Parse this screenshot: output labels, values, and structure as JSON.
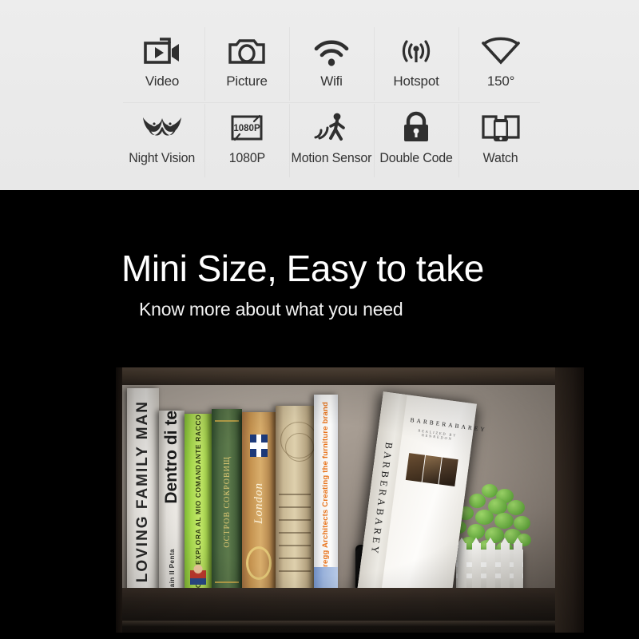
{
  "features": {
    "row1": [
      {
        "icon": "video-camera-icon",
        "label": "Video"
      },
      {
        "icon": "photo-camera-icon",
        "label": "Picture"
      },
      {
        "icon": "wifi-icon",
        "label": "Wifi"
      },
      {
        "icon": "hotspot-antenna-icon",
        "label": "Hotspot"
      },
      {
        "icon": "wide-angle-lens-icon",
        "label": "150°"
      }
    ],
    "row2": [
      {
        "icon": "owl-eyes-night-vision-icon",
        "label": "Night Vision"
      },
      {
        "icon": "screen-1080p-icon",
        "label": "1080P"
      },
      {
        "icon": "walking-person-motion-icon",
        "label": "Motion Sensor"
      },
      {
        "icon": "padlock-icon",
        "label": "Double Code"
      },
      {
        "icon": "two-phones-watch-icon",
        "label": "Watch"
      }
    ],
    "icon_1080p_text": "1080P"
  },
  "hero": {
    "headline": "Mini Size, Easy to take",
    "subheadline": "Know more about what you need"
  },
  "photo": {
    "caption_alt": "bookshelf-with-mini-camera-photo",
    "books": [
      {
        "name": "book-loving-family-man",
        "spine": "LOVING FAMILY MAN"
      },
      {
        "name": "book-dentro-di-te",
        "spine": "Dentro di te",
        "sub": "Alain II Penta"
      },
      {
        "name": "book-green-explorer",
        "spine": "A QUI TOCCA COLA EXPLORA AL MIO COMANDANTE RACCONTO MARCO"
      },
      {
        "name": "book-green-cloth",
        "spine": "ОСТРОВ СОКРОВИЩ"
      },
      {
        "name": "book-london",
        "spine": "London"
      },
      {
        "name": "book-map-paper",
        "spine": ""
      },
      {
        "name": "book-anderegg-architects",
        "spine": "Anderegg Architects Creating the furniture brand"
      }
    ],
    "big_book": {
      "name": "book-barberabarey",
      "spine": "BARBERABAREY",
      "spine_sub": "REALIZED BY HENREDON",
      "cover_title": "BARBERABAREY",
      "cover_sub": "REALIZED BY HENREDON"
    },
    "objects": [
      {
        "name": "mini-camera",
        "label": ""
      },
      {
        "name": "potted-plant",
        "label": ""
      }
    ]
  },
  "colors": {
    "panel_bg": "#ebebeb",
    "icon_dark": "#2f2f2f",
    "label_text": "#333333",
    "page_bg": "#000000",
    "headline_text": "#ffffff"
  }
}
